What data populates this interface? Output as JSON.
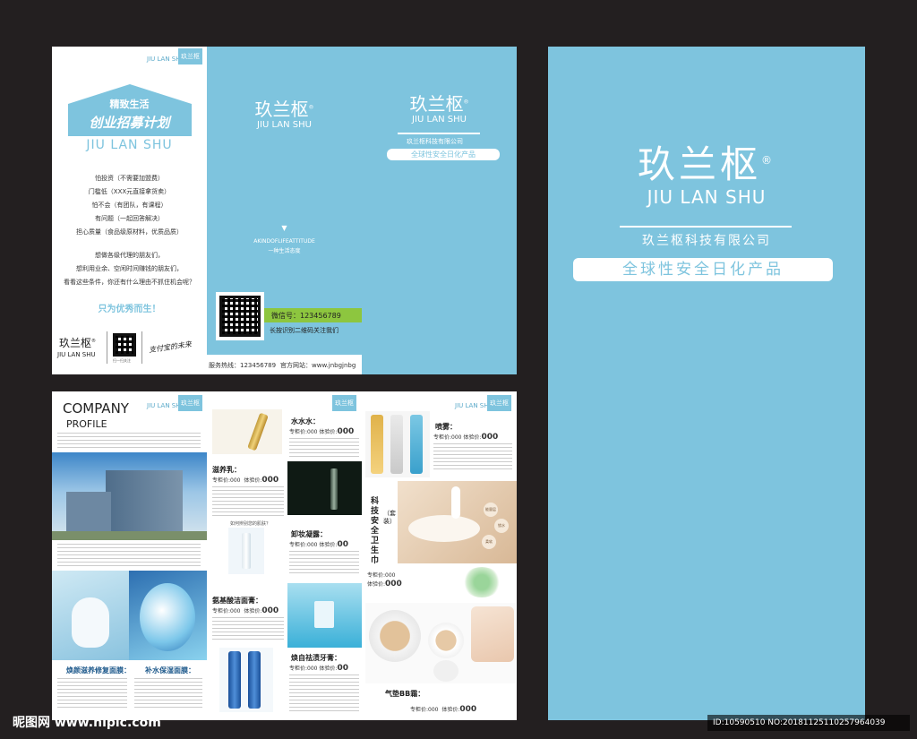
{
  "brand": {
    "cn": "玖兰枢",
    "en": "JIU LAN SHU",
    "reg": "®",
    "company": "玖兰枢科技有限公司",
    "slogan": "全球性安全日化产品"
  },
  "corner_tag": {
    "text": "JIU LAN SHU",
    "box": "玖兰枢"
  },
  "left_panel": {
    "house_title": "精致生活",
    "house_script": "创业招募计划",
    "brand_en": "JIU LAN SHU",
    "lines": [
      "怕投资（不需要加盟费）",
      "门槛低（XXX元直接拿货卖）",
      "怕不会（有团队，有课程）",
      "有问题（一起回答解决）",
      "担心质量（食品级原材料，优质品质）"
    ],
    "para": [
      "想做各级代理的朋友们，",
      "想利用业余、空闲时间赚钱的朋友们，",
      "看看这些条件，你还有什么理由不抓住机会呢？"
    ],
    "highlight": "只为优秀而生！",
    "footer_cn": "玖兰枢",
    "footer_en": "JIU LAN SHU",
    "qr_caption": "扫一扫关注",
    "signature": "支付宝的未来"
  },
  "mid_panel": {
    "brand_cn": "玖兰枢",
    "brand_en": "JIU LAN SHU",
    "arrow": "▼",
    "attitude_en": "AKINDOFLIFEATTITUDE",
    "attitude_cn": "一种生活态度",
    "wechat": "微信号：123456789",
    "scan_text": "长按识别二维码关注我们",
    "hotline": "服务热线：123456789",
    "website": "官方网站：www.jnbgjnbg"
  },
  "inner_cover": {
    "brand_cn": "玖兰枢",
    "brand_en": "JIU LAN SHU",
    "company": "玖兰枢科技有限公司",
    "slogan": "全球性安全日化产品"
  },
  "big_cover": {
    "brand_cn": "玖兰枢",
    "brand_en": "JIU LAN SHU",
    "company": "玖兰枢科技有限公司",
    "slogan": "全球性安全日化产品"
  },
  "company_panel": {
    "title": "COMPANY",
    "subtitle": "PROFILE",
    "product1": "焕颜滋养修复面膜：",
    "product2": "补水保湿面膜："
  },
  "products_a": {
    "items": [
      {
        "name": "水水水：",
        "label": "专柜价:000",
        "exp": "体验价:",
        "price": "000"
      },
      {
        "name": "滋养乳：",
        "label": "专柜价:000",
        "exp": "体验价:",
        "price": "000"
      },
      {
        "name": "卸妆凝露：",
        "label": "专柜价:000",
        "exp": "体验价:",
        "price": "00"
      },
      {
        "name": "氨基酸洁面膏：",
        "label": "专柜价:000",
        "exp": "体验价:",
        "price": "000"
      },
      {
        "name": "焕自祛渍牙膏：",
        "label": "专柜价:000",
        "exp": "体验价:",
        "price": "00"
      }
    ],
    "question": "如何辨别您的肌肤？"
  },
  "products_b": {
    "spray": {
      "name": "喷雾：",
      "label": "专柜价:000",
      "exp": "体验价:",
      "price": "000"
    },
    "vertical": "科技安全卫生巾",
    "set": "（套装）",
    "set_label": "专柜价:000",
    "set_exp": "体验价:",
    "set_price": "000",
    "bubbles": [
      "能量层",
      "锁水",
      "柔软"
    ],
    "bb": {
      "name": "气垫BB霜：",
      "label": "专柜价:000",
      "exp": "体验价:",
      "price": "000"
    }
  },
  "watermark": {
    "site": "昵图网 www.nipic.com",
    "id": "ID:10590510 NO:20181125110257964039"
  },
  "colors": {
    "accent": "#7ec4de",
    "background": "#231f20",
    "green": "#8dc63f"
  }
}
